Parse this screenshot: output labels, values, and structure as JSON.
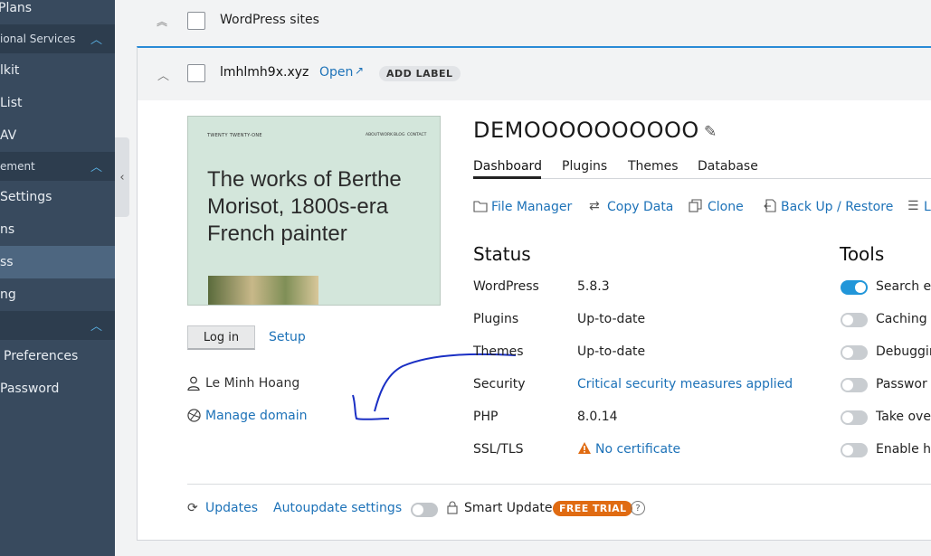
{
  "sidebar": {
    "items": [
      {
        "label": "Plans"
      },
      {
        "label": "ional Services",
        "section": true
      },
      {
        "label": "lkit"
      },
      {
        "label": "List"
      },
      {
        "label": "AV"
      },
      {
        "label": "ement",
        "section": true
      },
      {
        "label": "Settings"
      },
      {
        "label": "ns"
      },
      {
        "label": "ss",
        "active": true
      },
      {
        "label": "ng"
      },
      {
        "label": "",
        "section": true
      },
      {
        "label": "Preferences"
      },
      {
        "label": "Password"
      }
    ],
    "collapse_icon": "chevron-left-icon"
  },
  "group": {
    "title": "WordPress sites"
  },
  "site": {
    "domain": "lmhlmh9x.xyz",
    "open_link": "Open",
    "add_label": "ADD LABEL",
    "title": "DEMOOOOOOOOOO",
    "thumbnail": {
      "brand": "TWENTY TWENTY-ONE",
      "nav": [
        "ABOUT",
        "WORK",
        "BLOG",
        "CONTACT"
      ],
      "headline_1": "The works of Berthe",
      "headline_2": "Morisot, 1800s-era",
      "headline_3": "French painter"
    },
    "login_button": "Log in",
    "setup_link": "Setup",
    "owner": "Le Minh Hoang",
    "manage_domain": "Manage domain"
  },
  "tabs": [
    "Dashboard",
    "Plugins",
    "Themes",
    "Database"
  ],
  "actions": [
    "File Manager",
    "Copy Data",
    "Clone",
    "Back Up / Restore",
    "L"
  ],
  "status": {
    "heading": "Status",
    "rows": [
      {
        "label": "WordPress",
        "value": "5.8.3"
      },
      {
        "label": "Plugins",
        "value": "Up-to-date"
      },
      {
        "label": "Themes",
        "value": "Up-to-date"
      },
      {
        "label": "Security",
        "value": "Critical security measures applied"
      },
      {
        "label": "PHP",
        "value": "8.0.14"
      },
      {
        "label": "SSL/TLS",
        "value": "No certificate"
      }
    ]
  },
  "tools": {
    "heading": "Tools",
    "items": [
      {
        "label": "Search en",
        "on": true
      },
      {
        "label": "Caching (",
        "on": false
      },
      {
        "label": "Debuggin",
        "on": false
      },
      {
        "label": "Passwor",
        "on": false
      },
      {
        "label": "Take over",
        "on": false
      },
      {
        "label": "Enable ho",
        "on": false
      }
    ]
  },
  "footer": {
    "updates": "Updates",
    "autoupdate": "Autoupdate settings",
    "smart_update": "Smart Update",
    "trial": "FREE TRIAL",
    "help": "?"
  },
  "colors": {
    "sidebar": "#384a5e",
    "accent": "#1d72b8",
    "trial": "#e06b12",
    "warning": "#e06b12"
  }
}
